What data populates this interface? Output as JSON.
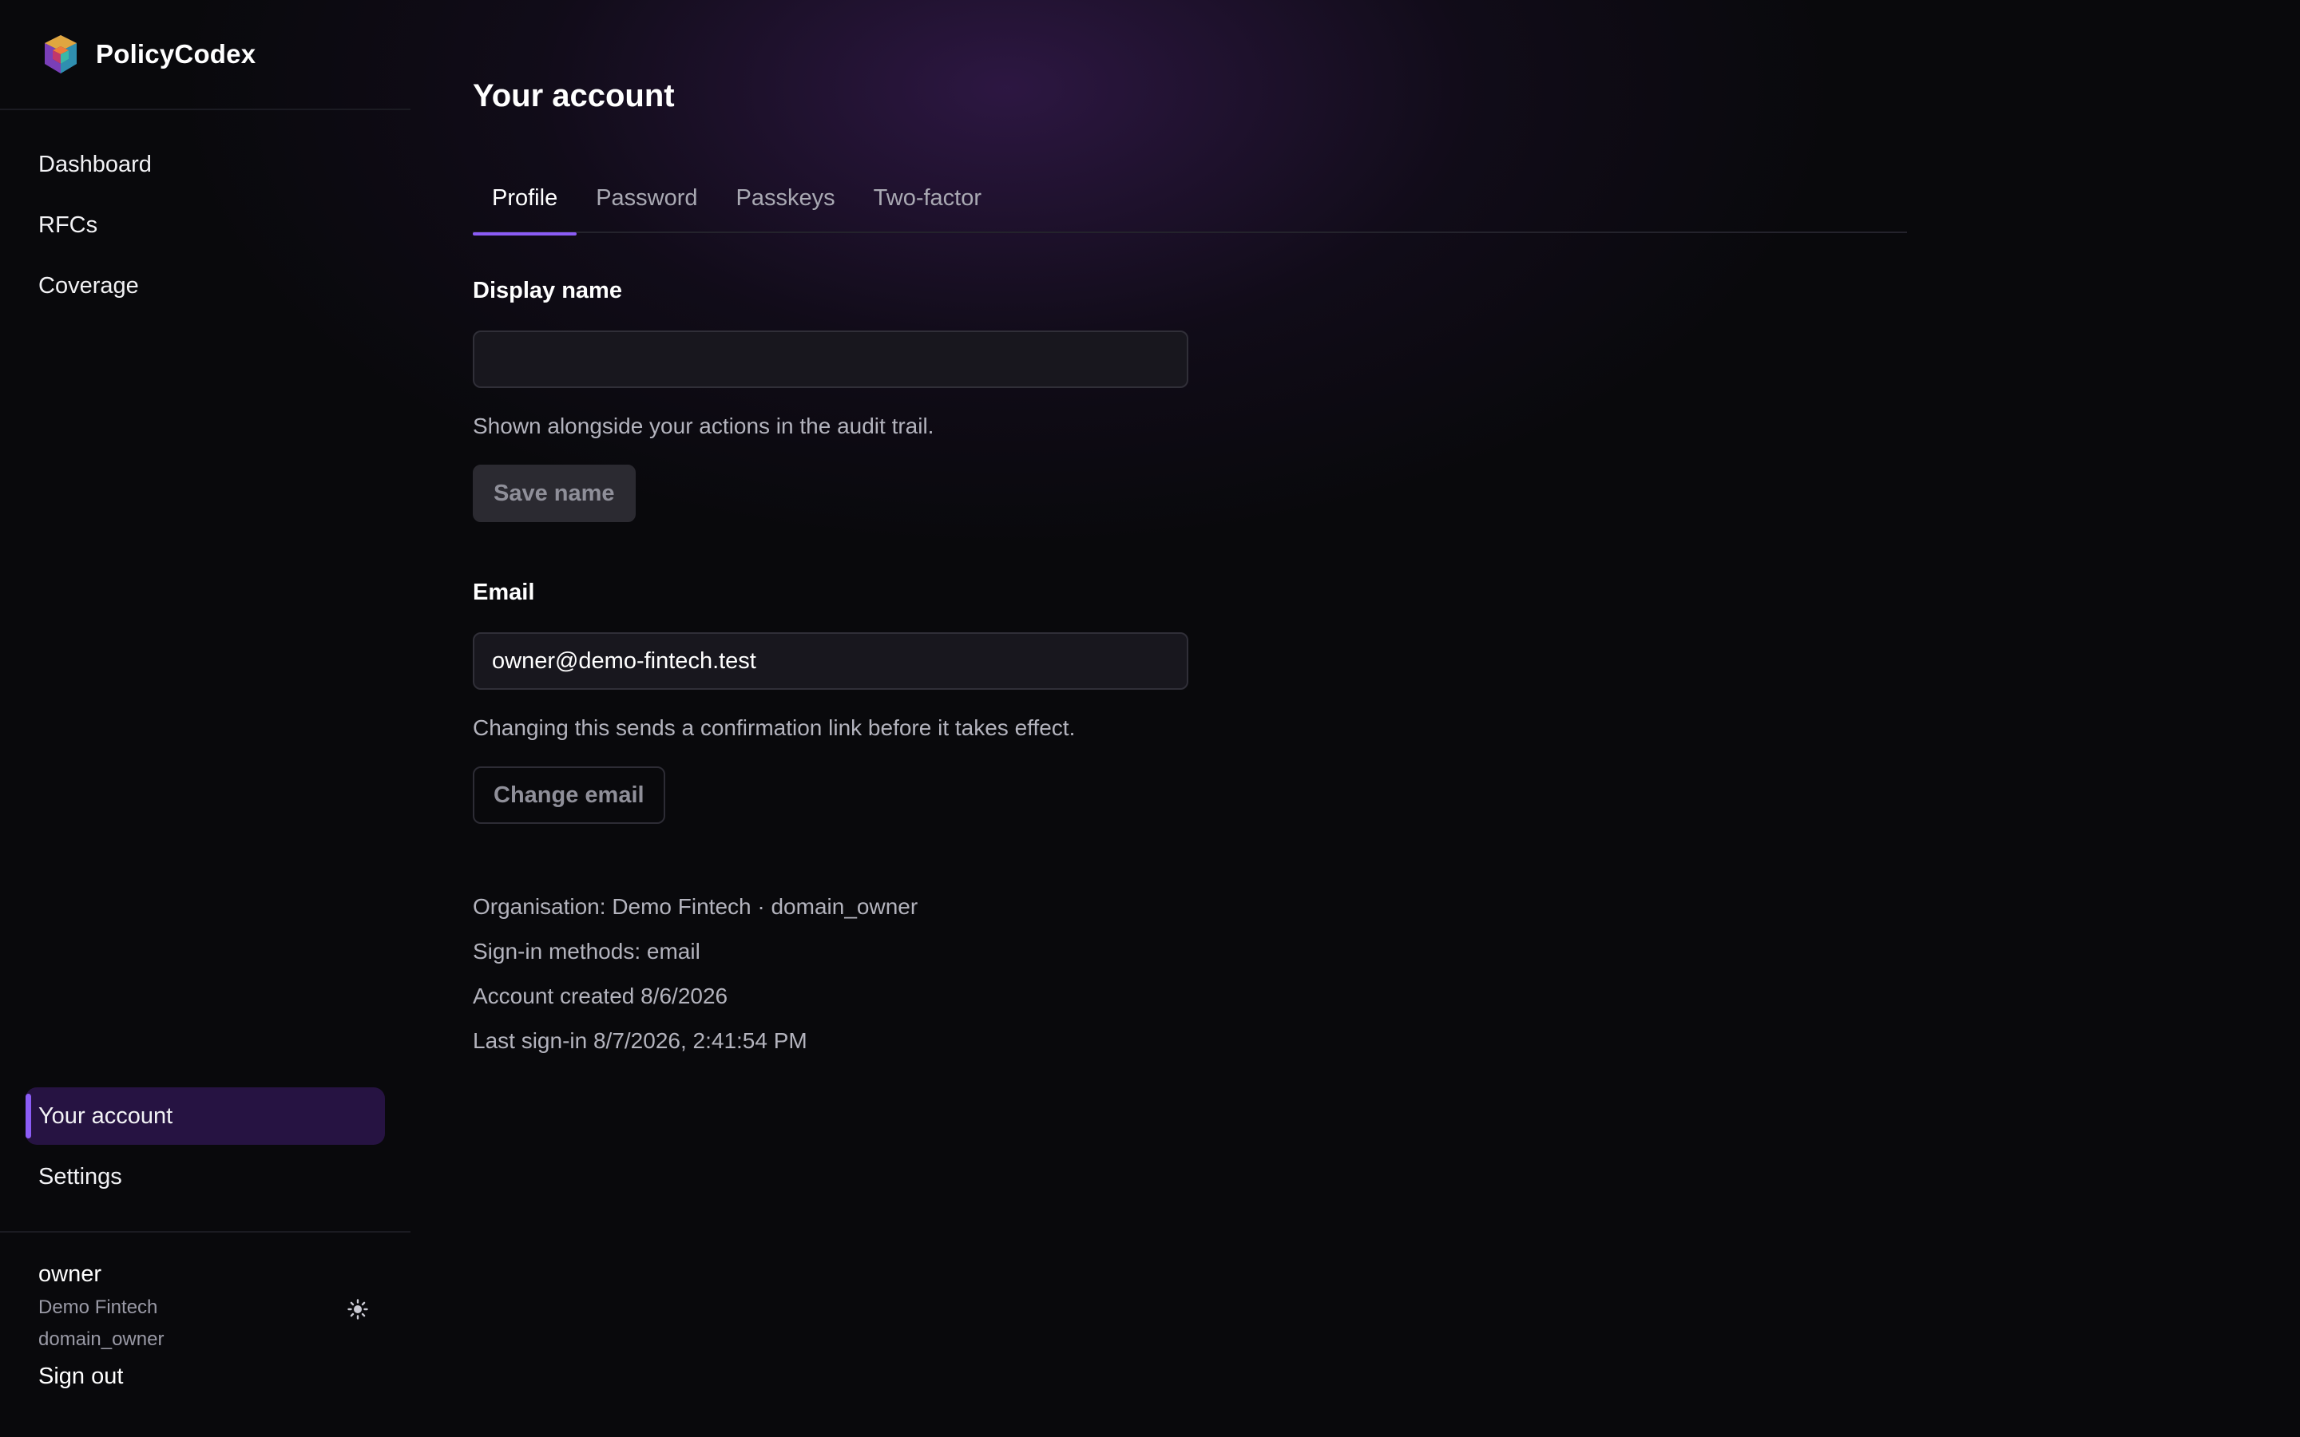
{
  "brand": {
    "name": "PolicyCodex"
  },
  "nav": {
    "top_items": [
      {
        "label": "Dashboard"
      },
      {
        "label": "RFCs"
      },
      {
        "label": "Coverage"
      }
    ],
    "bottom_items": [
      {
        "label": "Your account",
        "active": true
      },
      {
        "label": "Settings",
        "active": false
      }
    ]
  },
  "user": {
    "name": "owner",
    "organisation": "Demo Fintech",
    "role": "domain_owner",
    "theme_icon": "sun-icon",
    "sign_out_label": "Sign out"
  },
  "page": {
    "title": "Your account"
  },
  "tabs": [
    {
      "label": "Profile",
      "active": true
    },
    {
      "label": "Password",
      "active": false
    },
    {
      "label": "Passkeys",
      "active": false
    },
    {
      "label": "Two-factor",
      "active": false
    }
  ],
  "profile": {
    "display_name": {
      "label": "Display name",
      "value": "",
      "help": "Shown alongside your actions in the audit trail.",
      "button": "Save name"
    },
    "email": {
      "label": "Email",
      "value": "owner@demo-fintech.test",
      "help": "Changing this sends a confirmation link before it takes effect.",
      "button": "Change email"
    },
    "meta": {
      "organisation": "Organisation: Demo Fintech · domain_owner",
      "sign_in_methods": "Sign-in methods: email",
      "created": "Account created 8/6/2026",
      "last_sign_in": "Last sign-in 8/7/2026, 2:41:54 PM"
    }
  },
  "colors": {
    "accent": "#8b5cf6",
    "active_nav_bg": "#261342",
    "background": "#09090c"
  }
}
